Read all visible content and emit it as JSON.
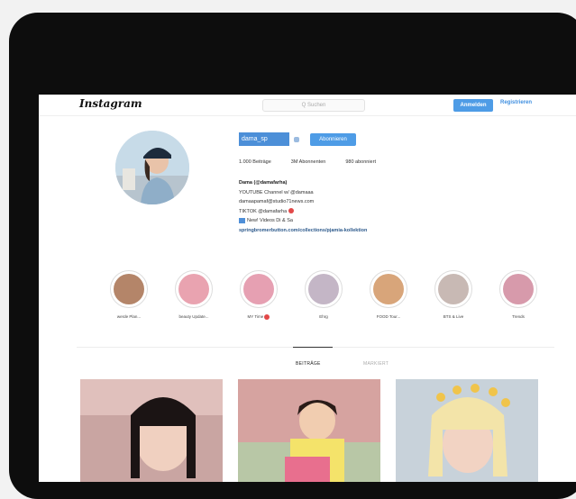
{
  "header": {
    "logo": "Instagram",
    "search_placeholder": "Q Suchen",
    "login_label": "Anmelden",
    "signup_label": "Registrieren"
  },
  "profile": {
    "username": "dama_sp",
    "follow_label": "Abonnieren",
    "stats": [
      "1.000 Beiträge",
      "3M Abonnenten",
      "980 abonniert"
    ],
    "bio": {
      "name": "Dama (@damafarha)",
      "lines": [
        "YOUTUBE Channel w/ @damaaa",
        "damaapamaf@studio71news.com",
        "TIKTOK @damafarha",
        "New! Videos Di & Sa"
      ],
      "link": "springbromerbutton.com/collections/pjamia-kollektion"
    }
  },
  "highlights": [
    {
      "label": "werde Plan...",
      "color": "#b48569"
    },
    {
      "label": "beauty Update...",
      "color": "#e9a3b0"
    },
    {
      "label": "MY Time",
      "color": "#e6a0b2"
    },
    {
      "label": "Ehrg",
      "color": "#c4b6c6"
    },
    {
      "label": "FOOD Tour...",
      "color": "#d8a57a"
    },
    {
      "label": "BTS & Live",
      "color": "#c8b9b4"
    },
    {
      "label": "Trends",
      "color": "#d79aab"
    }
  ],
  "tabs": [
    {
      "label": "BEITRÄGE",
      "active": true
    },
    {
      "label": "MARKIERT",
      "active": false
    }
  ],
  "posts": [
    {
      "bg": "#d9a8a5"
    },
    {
      "bg": "#e4b58d"
    },
    {
      "bg": "#cbd3da"
    }
  ],
  "colors": {
    "accent": "#4e9ce6",
    "device": "#0d0d0d"
  }
}
